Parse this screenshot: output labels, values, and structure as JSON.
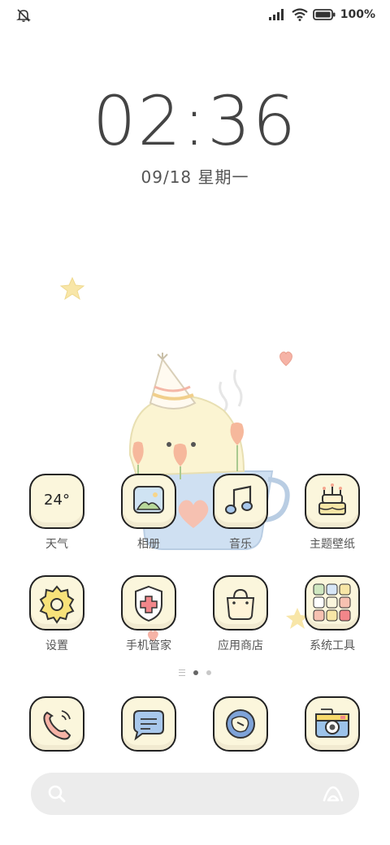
{
  "status": {
    "battery": "100%"
  },
  "lock": {
    "time": "02:36",
    "date": "09/18 星期一"
  },
  "apps_row1": [
    {
      "label": "天气",
      "icon": "weather-icon",
      "temp": "24°"
    },
    {
      "label": "相册",
      "icon": "gallery-icon"
    },
    {
      "label": "音乐",
      "icon": "music-icon"
    },
    {
      "label": "主题壁纸",
      "icon": "themes-icon"
    }
  ],
  "apps_row2": [
    {
      "label": "设置",
      "icon": "settings-icon"
    },
    {
      "label": "手机管家",
      "icon": "security-icon"
    },
    {
      "label": "应用商店",
      "icon": "app-store-icon"
    },
    {
      "label": "系统工具",
      "icon": "tools-folder-icon"
    }
  ],
  "dock": [
    {
      "icon": "phone-icon"
    },
    {
      "icon": "messages-icon"
    },
    {
      "icon": "browser-icon"
    },
    {
      "icon": "camera-icon"
    }
  ],
  "pager": {
    "pages": 2,
    "active": 0
  },
  "colors": {
    "background": "#ffffff",
    "icon_bg": "#fbf6dc",
    "outline": "#222222",
    "search_bg": "#ececec"
  }
}
